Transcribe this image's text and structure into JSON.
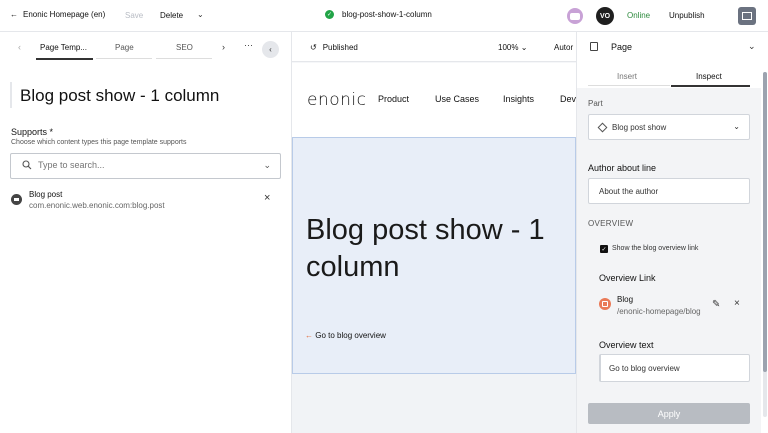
{
  "topbar": {
    "back_label": "Enonic Homepage (en)",
    "save_label": "Save",
    "delete_label": "Delete",
    "status_label": "blog-post-show-1-column",
    "avatar_initials": "VO",
    "online_label": "Online",
    "unpublish_label": "Unpublish"
  },
  "left": {
    "tabs": [
      "Page Temp...",
      "Page",
      "SEO"
    ],
    "page_title": "Blog post show - 1 column",
    "supports_label": "Supports *",
    "supports_desc": "Choose which content types this page template supports",
    "search_placeholder": "Type to search...",
    "content_type": {
      "name": "Blog post",
      "id": "com.enonic.web.enonic.com:blog.post"
    }
  },
  "center": {
    "published_label": "Published",
    "zoom_label": "100%",
    "auto_label": "Autor",
    "logo": "enonic",
    "nav": [
      "Product",
      "Use Cases",
      "Insights",
      "Dev"
    ],
    "hero_title": "Blog post show - 1 column",
    "back_link": "Go to blog overview"
  },
  "right": {
    "title": "Page",
    "tabs": [
      "Insert",
      "Inspect"
    ],
    "part_label": "Part",
    "part_value": "Blog post show",
    "author_label": "Author about line",
    "author_value": "About the author",
    "overview_heading": "OVERVIEW",
    "show_overview_label": "Show the blog overview link",
    "overview_link_label": "Overview Link",
    "link_name": "Blog",
    "link_path": "/enonic-homepage/blog",
    "overview_text_label": "Overview text",
    "overview_text_value": "Go to blog overview",
    "apply_label": "Apply"
  },
  "colors": {
    "accent": "#22a447",
    "link_icon": "#ea7a57",
    "hero_bg": "#e8eef8"
  }
}
